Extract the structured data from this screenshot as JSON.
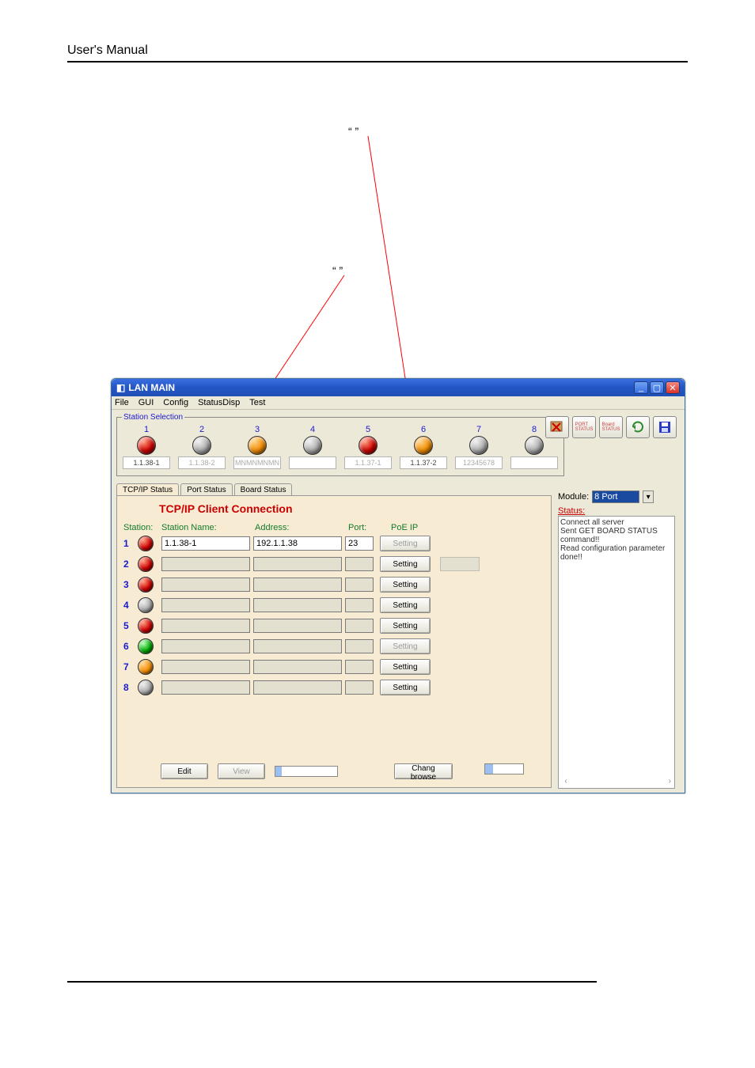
{
  "page": {
    "header": "User's  Manual"
  },
  "callouts": {
    "top": "“       ”",
    "mid": "“      ”"
  },
  "window": {
    "title": "LAN MAIN",
    "menu": [
      "File",
      "GUI",
      "Config",
      "StatusDisp",
      "Test"
    ]
  },
  "station_selection": {
    "legend": "Station Selection",
    "items": [
      {
        "num": "1",
        "led": "red",
        "label": "1.1.38-1",
        "enabled": true
      },
      {
        "num": "2",
        "led": "gray",
        "label": "1.1.38-2",
        "enabled": false
      },
      {
        "num": "3",
        "led": "orange",
        "label": "MNMNMNMN",
        "enabled": false
      },
      {
        "num": "4",
        "led": "gray",
        "label": "",
        "enabled": false
      },
      {
        "num": "5",
        "led": "red",
        "label": "1.1.37-1",
        "enabled": false
      },
      {
        "num": "6",
        "led": "orange",
        "label": "1.1.37-2",
        "enabled": true
      },
      {
        "num": "7",
        "led": "gray",
        "label": "12345678",
        "enabled": false
      },
      {
        "num": "8",
        "led": "gray",
        "label": "",
        "enabled": false
      }
    ]
  },
  "toolbar": {
    "icons": [
      "connect",
      "port-status",
      "board-status",
      "refresh",
      "save"
    ]
  },
  "module": {
    "label": "Module:",
    "value": "8 Port"
  },
  "status_panel": {
    "label": "Status:",
    "lines": [
      "Connect all server",
      "Sent GET BOARD STATUS command!!",
      "Read configuration parameter done!!"
    ]
  },
  "tabs": {
    "items": [
      "TCP/IP Status",
      "Port Status",
      "Board Status"
    ],
    "active": 0
  },
  "tcpip_panel": {
    "title": "TCP/IP Client Connection",
    "headers": {
      "station": "Station:",
      "name": "Station Name:",
      "address": "Address:",
      "port": "Port:",
      "poe": "PoE IP"
    },
    "rows": [
      {
        "n": "1",
        "led": "red",
        "name": "1.1.38-1",
        "addr": "192.1.1.38",
        "port": "23",
        "btn": "Setting",
        "btn_enabled": false
      },
      {
        "n": "2",
        "led": "red",
        "name": "",
        "addr": "",
        "port": "",
        "btn": "Setting",
        "btn_enabled": true
      },
      {
        "n": "3",
        "led": "red",
        "name": "",
        "addr": "",
        "port": "",
        "btn": "Setting",
        "btn_enabled": true
      },
      {
        "n": "4",
        "led": "gray",
        "name": "",
        "addr": "",
        "port": "",
        "btn": "Setting",
        "btn_enabled": true
      },
      {
        "n": "5",
        "led": "red",
        "name": "",
        "addr": "",
        "port": "",
        "btn": "Setting",
        "btn_enabled": true
      },
      {
        "n": "6",
        "led": "green",
        "name": "",
        "addr": "",
        "port": "",
        "btn": "Setting",
        "btn_enabled": false
      },
      {
        "n": "7",
        "led": "orange",
        "name": "",
        "addr": "",
        "port": "",
        "btn": "Setting",
        "btn_enabled": true
      },
      {
        "n": "8",
        "led": "gray",
        "name": "",
        "addr": "",
        "port": "",
        "btn": "Setting",
        "btn_enabled": true
      }
    ],
    "buttons": {
      "edit": "Edit",
      "view": "View",
      "change": "Chang browse"
    }
  }
}
